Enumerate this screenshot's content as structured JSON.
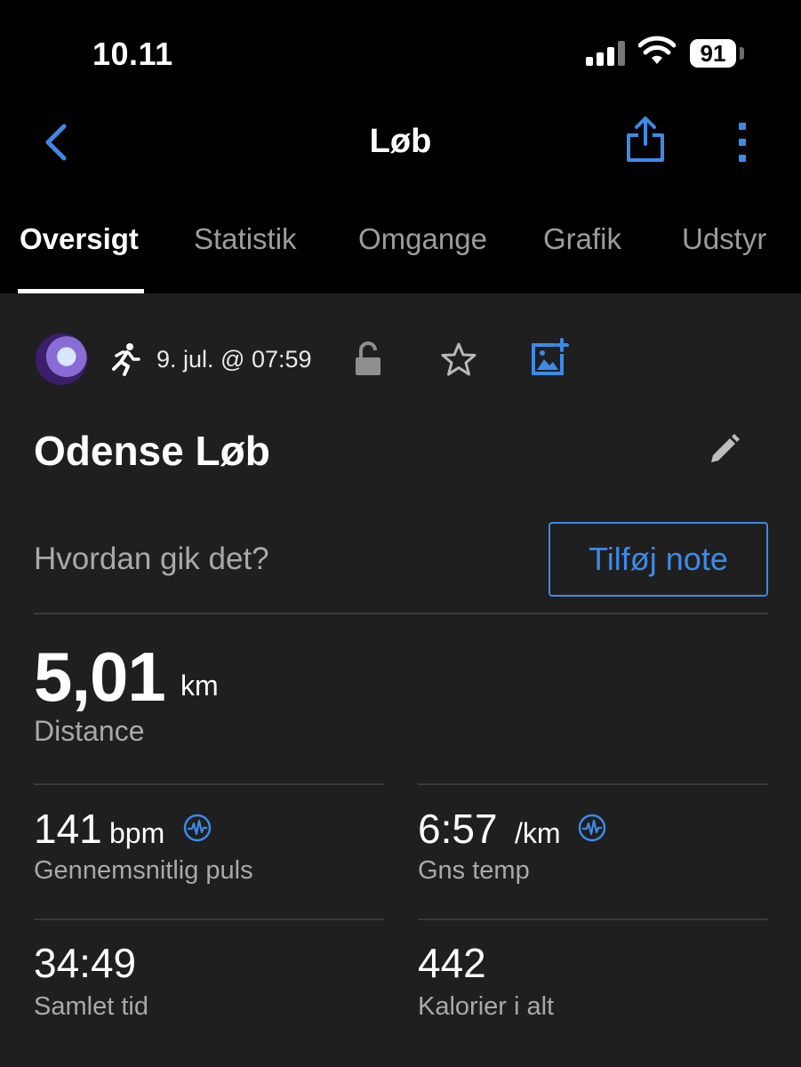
{
  "status_bar": {
    "time": "10.11",
    "battery": "91"
  },
  "nav": {
    "title": "Løb"
  },
  "tabs": [
    {
      "label": "Oversigt",
      "active": true
    },
    {
      "label": "Statistik"
    },
    {
      "label": "Omgange"
    },
    {
      "label": "Grafik"
    },
    {
      "label": "Udstyr"
    }
  ],
  "activity": {
    "date": "9. jul. @ 07:59",
    "title": "Odense Løb",
    "note_prompt": "Hvordan gik det?",
    "note_button": "Tilføj note"
  },
  "distance": {
    "value": "5,01",
    "unit": "km",
    "label": "Distance"
  },
  "stats": [
    {
      "value": "141",
      "unit": "bpm",
      "label": "Gennemsnitlig puls"
    },
    {
      "value": "6:57",
      "unit": "/km",
      "label": "Gns temp"
    },
    {
      "value": "34:49",
      "label": "Samlet tid"
    },
    {
      "value": "442",
      "label": "Kalorier i alt"
    }
  ],
  "colors": {
    "accent": "#3d8ae8",
    "background": "#1f1f1f",
    "header": "#000000"
  },
  "icons": [
    "back-icon",
    "share-icon",
    "more-icon",
    "runner-icon",
    "unlock-icon",
    "star-icon",
    "add-photo-icon",
    "edit-icon",
    "heart-rate-icon"
  ]
}
